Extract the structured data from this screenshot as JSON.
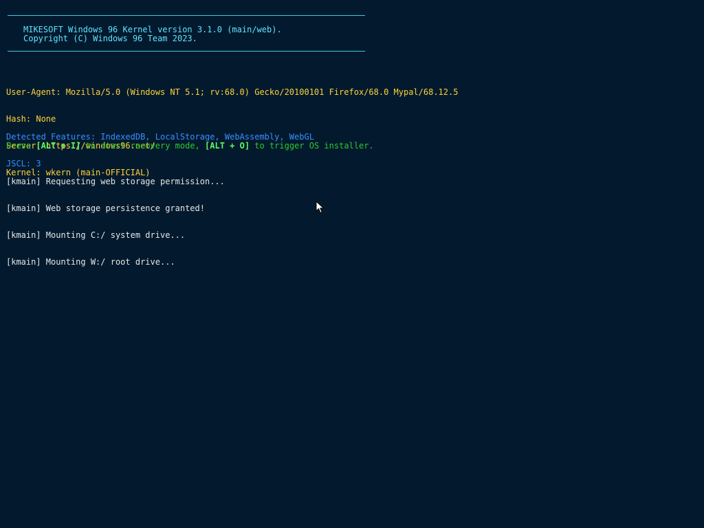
{
  "banner": {
    "line1": "MIKESOFT Windows 96 Kernel version 3.1.0 (main/web).",
    "line2": "Copyright (C) Windows 96 Team 2023."
  },
  "info": {
    "user_agent": "User-Agent: Mozilla/5.0 (Windows NT 5.1; rv:68.0) Gecko/20100101 Firefox/68.0 Mypal/68.12.5",
    "hash": "Hash: None",
    "server": "Server: https://windows96.net/",
    "kernel": "Kernel: wkern (main-OFFICIAL)"
  },
  "features": {
    "detected": "Detected Features: IndexedDB, LocalStorage, WebAssembly, WebGL",
    "jscl": "JSCL: 3"
  },
  "press": {
    "prefix": "Press ",
    "key1": "[ALT + I]",
    "middle": " to start recovery mode, ",
    "key2": "[ALT + O]",
    "suffix": " to trigger OS installer."
  },
  "log": [
    "[kmain] Requesting web storage permission...",
    "[kmain] Web storage persistence granted!",
    "[kmain] Mounting C:/ system drive...",
    "[kmain] Mounting W:/ root drive..."
  ],
  "colors": {
    "background": "#031a2e",
    "banner": "#5fe3ff",
    "info": "#ffd23a",
    "features": "#3a8dff",
    "press": "#2ec82e",
    "log": "#e6e6e6"
  },
  "icons": {
    "cursor": "mouse-pointer-icon"
  }
}
